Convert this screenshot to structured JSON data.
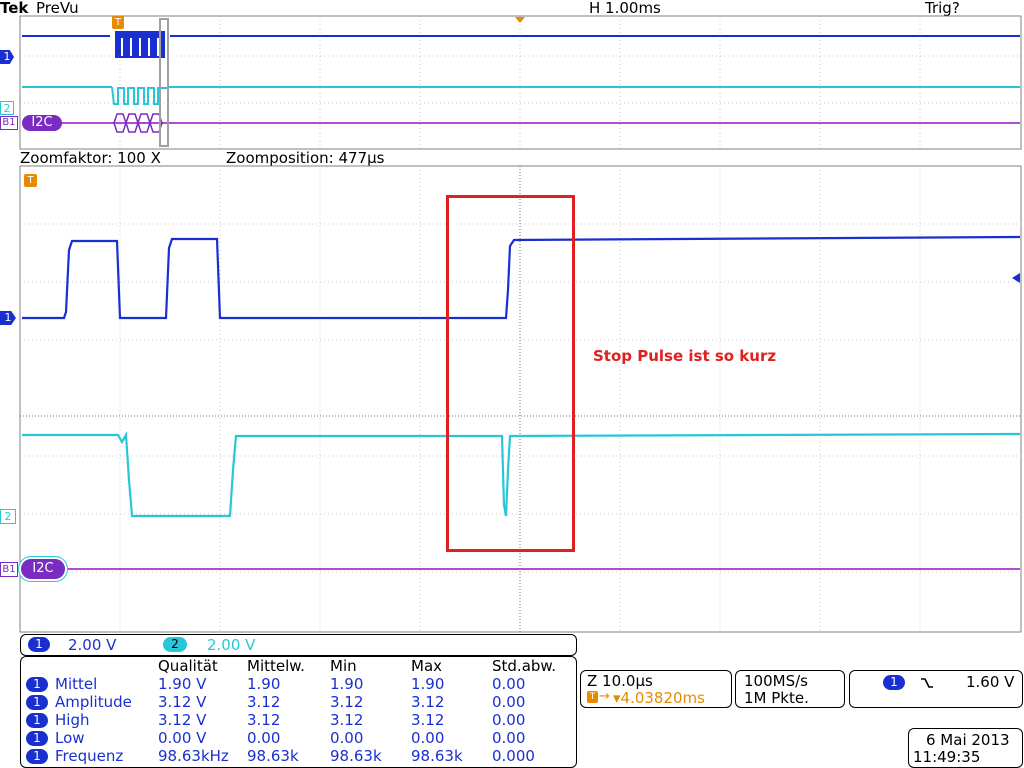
{
  "header": {
    "brand": "Tek",
    "mode": "PreVu",
    "horizontal": "H 1.00ms",
    "trigger_status": "Trig?"
  },
  "zoom_bar": {
    "factor": "Zoomfaktor: 100 X",
    "position": "Zoomposition: 477µs"
  },
  "markers": {
    "ch1": "1",
    "ch2": "2",
    "bus": "B1",
    "trigger": "T"
  },
  "bus_label": "I2C",
  "annotation": "Stop Pulse ist so kurz",
  "channel_bar": {
    "ch1_num": "1",
    "ch1_scale": "2.00 V",
    "ch2_num": "2",
    "ch2_scale": "2.00 V"
  },
  "measurements": {
    "headers": [
      "Qualität",
      "Mittelw.",
      "Min",
      "Max",
      "Std.abw."
    ],
    "rows": [
      {
        "ch": "1",
        "name": "Mittel",
        "values": [
          "1.90 V",
          "1.90",
          "1.90",
          "1.90",
          "0.00"
        ]
      },
      {
        "ch": "1",
        "name": "Amplitude",
        "values": [
          "3.12 V",
          "3.12",
          "3.12",
          "3.12",
          "0.00"
        ]
      },
      {
        "ch": "1",
        "name": "High",
        "values": [
          "3.12 V",
          "3.12",
          "3.12",
          "3.12",
          "0.00"
        ]
      },
      {
        "ch": "1",
        "name": "Low",
        "values": [
          "0.00 V",
          "0.00",
          "0.00",
          "0.00",
          "0.00"
        ]
      },
      {
        "ch": "1",
        "name": "Frequenz",
        "values": [
          "98.63kHz",
          "98.63k",
          "98.63k",
          "98.63k",
          "0.000"
        ]
      }
    ]
  },
  "timebase": {
    "zoom_scale": "Z 10.0µs",
    "trigger_pos": "▾4.03820ms"
  },
  "acquisition": {
    "rate": "100MS/s",
    "points": "1M Pkte."
  },
  "trigger": {
    "ch": "1",
    "slope_icon": "falling-edge-icon",
    "level": "1.60 V"
  },
  "datetime": {
    "date": "6 Mai  2013",
    "time": "11:49:35"
  },
  "colors": {
    "ch1": "#1a2fd0",
    "ch2": "#27c7d8",
    "bus": "#7a2bc2",
    "trigger": "#e88a00",
    "annotation": "#e02020"
  }
}
